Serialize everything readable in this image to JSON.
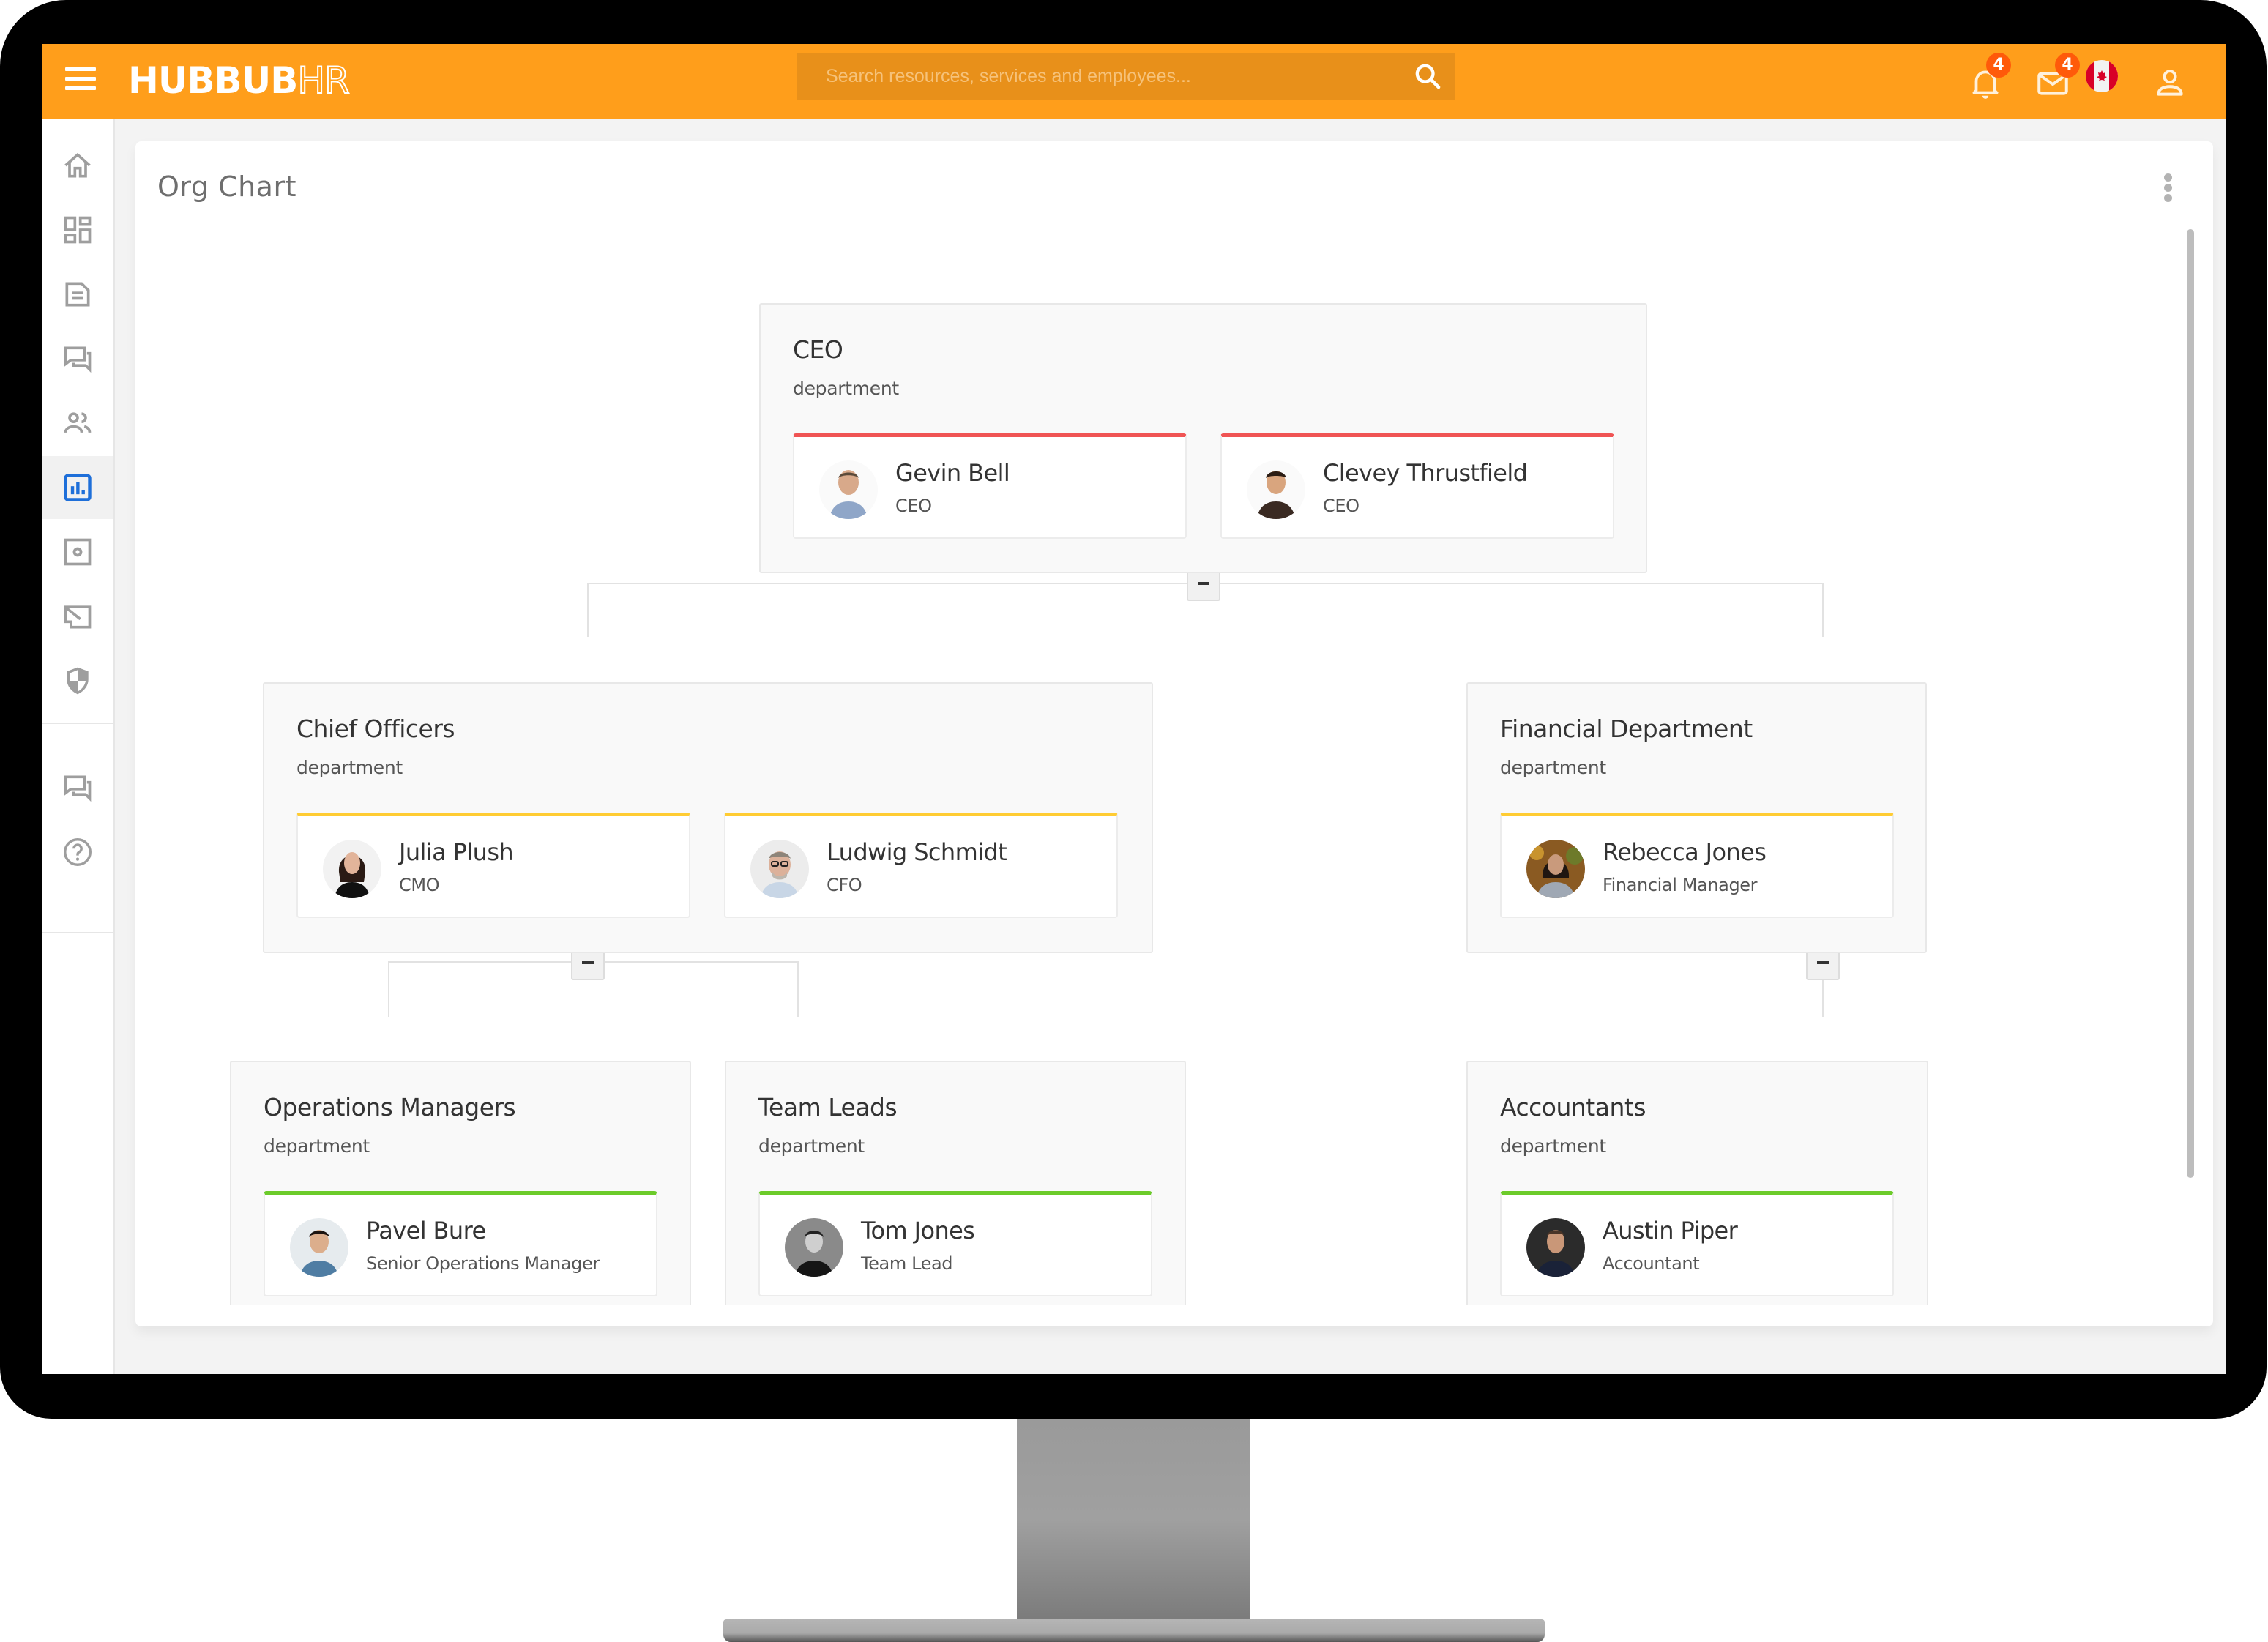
{
  "app": {
    "brand_bold": "HUBBUB",
    "brand_outline": "HR",
    "brand_color": "#FF9E1B"
  },
  "header": {
    "search_placeholder": "Search resources, services and employees...",
    "notifications_count": "4",
    "messages_count": "4",
    "icons": [
      "menu-icon",
      "search-icon",
      "bell-icon",
      "mail-icon",
      "canada-flag-icon",
      "user-icon"
    ]
  },
  "sidebar": {
    "items": [
      {
        "icon": "home-icon",
        "active": false
      },
      {
        "icon": "dashboard-icon",
        "active": false
      },
      {
        "icon": "document-icon",
        "active": false
      },
      {
        "icon": "chat-icon",
        "active": false
      },
      {
        "icon": "people-icon",
        "active": false
      },
      {
        "icon": "chart-icon",
        "active": true
      },
      {
        "icon": "settings-icon",
        "active": false
      },
      {
        "icon": "megaphone-icon",
        "active": false
      },
      {
        "icon": "shield-icon",
        "active": false
      }
    ],
    "bottom_items": [
      {
        "icon": "chat-icon"
      },
      {
        "icon": "help-icon"
      }
    ]
  },
  "page": {
    "title": "Org Chart"
  },
  "org": {
    "departments": [
      {
        "name": "CEO",
        "type": "department",
        "accent": "#F05454",
        "employees": [
          {
            "name": "Gevin Bell",
            "title": "CEO"
          },
          {
            "name": "Clevey Thrustfield",
            "title": "CEO"
          }
        ]
      },
      {
        "name": "Chief Officers",
        "type": "department",
        "accent": "#FFCC33",
        "employees": [
          {
            "name": "Julia Plush",
            "title": "CMO"
          },
          {
            "name": "Ludwig Schmidt",
            "title": "CFO"
          }
        ]
      },
      {
        "name": "Financial Department",
        "type": "department",
        "accent": "#FFCC33",
        "employees": [
          {
            "name": "Rebecca Jones",
            "title": "Financial Manager"
          }
        ]
      },
      {
        "name": "Operations Managers",
        "type": "department",
        "accent": "#6CCB2A",
        "employees": [
          {
            "name": "Pavel Bure",
            "title": "Senior Operations Manager"
          }
        ]
      },
      {
        "name": "Team Leads",
        "type": "department",
        "accent": "#6CCB2A",
        "employees": [
          {
            "name": "Tom Jones",
            "title": "Team Lead"
          }
        ]
      },
      {
        "name": "Accountants",
        "type": "department",
        "accent": "#6CCB2A",
        "employees": [
          {
            "name": "Austin Piper",
            "title": "Accountant"
          }
        ]
      }
    ]
  }
}
